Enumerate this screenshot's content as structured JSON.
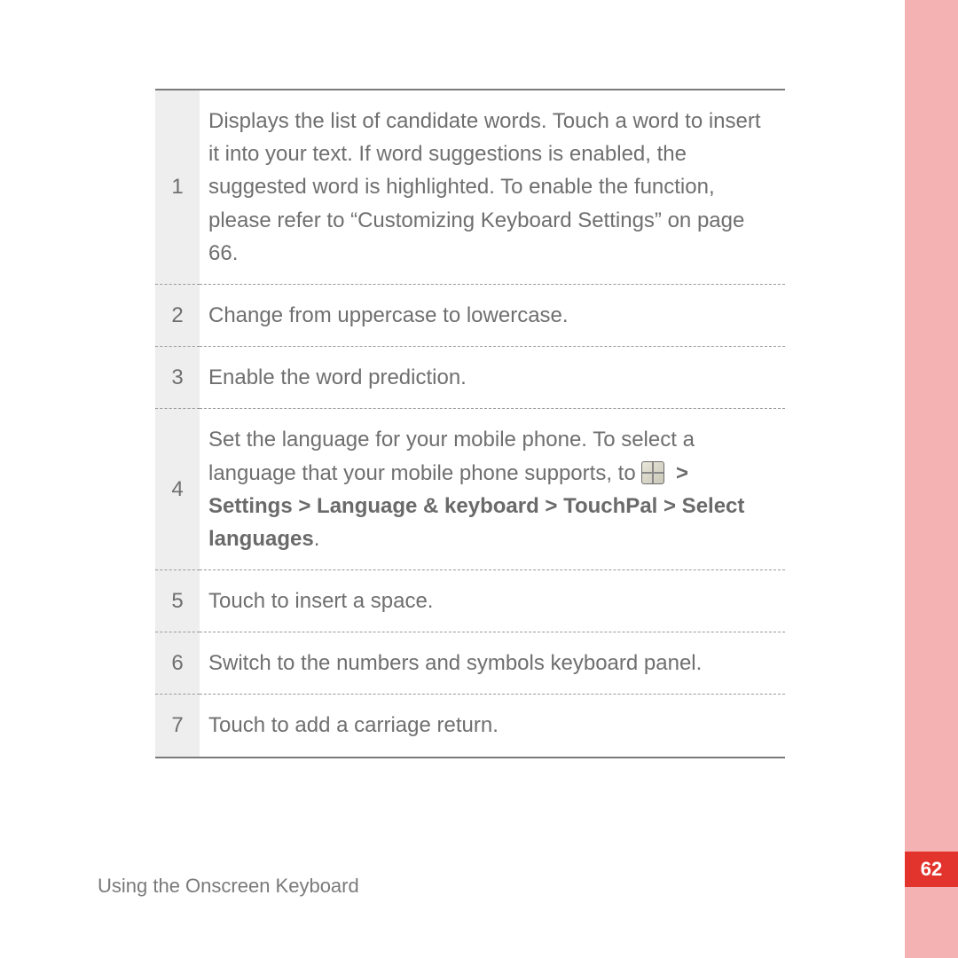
{
  "rows": [
    {
      "num": "1",
      "desc": "Displays the list of candidate words. Touch a word to insert it into your text. If word suggestions is enabled, the suggested word is highlighted. To enable the function, please refer to “Customizing Keyboard Settings” on page 66."
    },
    {
      "num": "2",
      "desc": "Change from uppercase to lowercase."
    },
    {
      "num": "3",
      "desc": "Enable the word prediction."
    },
    {
      "num": "4",
      "desc_prefix": "Set the language for your mobile phone. To select a language that your mobile phone supports, to ",
      "path": " > Settings > Language & keyboard > TouchPal > Select languages",
      "desc_suffix": "."
    },
    {
      "num": "5",
      "desc": "Touch to insert a space."
    },
    {
      "num": "6",
      "desc": "Switch to the numbers and symbols keyboard panel."
    },
    {
      "num": "7",
      "desc": "Touch to add a carriage return."
    }
  ],
  "footer": "Using the Onscreen Keyboard",
  "page_number": "62"
}
